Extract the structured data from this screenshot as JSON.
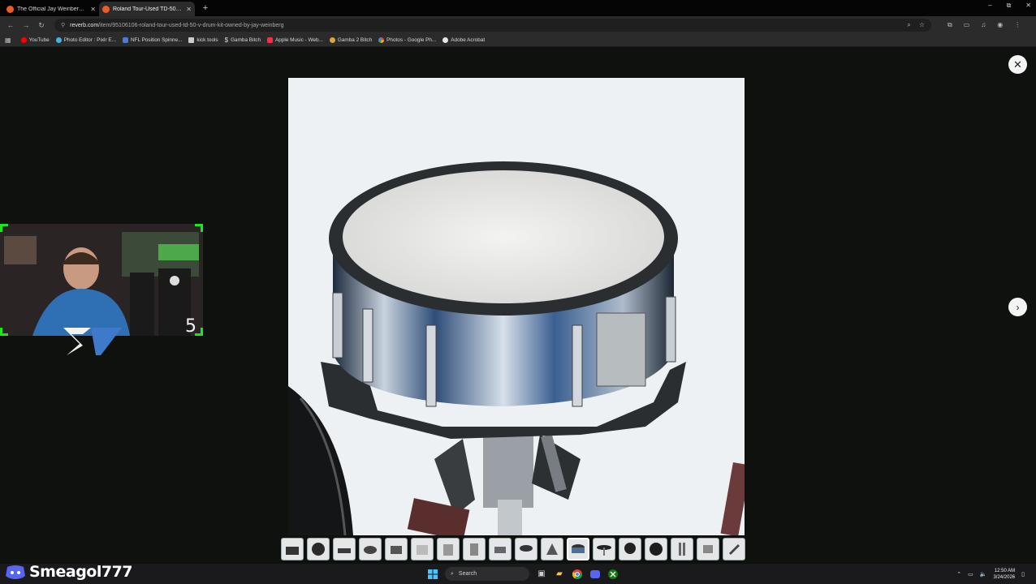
{
  "browser": {
    "tabs": [
      {
        "title": "The Official Jay Weinberg Reverb",
        "active": false
      },
      {
        "title": "Roland Tour-Used TD-50 V-Drum",
        "active": true
      }
    ],
    "new_tab": "+",
    "window_controls": {
      "minimize": "–",
      "restore": "⧉",
      "close": "✕"
    },
    "url_host": "reverb.com",
    "url_path": "/item/95106106-roland-tour-used-td-50-v-drum-kit-owned-by-jay-weinberg",
    "bookmarks": [
      {
        "label": "YouTube",
        "color": "#ff0000"
      },
      {
        "label": "Photo Editor : Pixlr E...",
        "color": "#3fb6e8"
      },
      {
        "label": "NFL Position Spinne...",
        "color": "#4b7bd6"
      },
      {
        "label": "kick tools",
        "color": "#cccccc"
      },
      {
        "label": "Gamba Bitch",
        "color": "#bbbbbb"
      },
      {
        "label": "Apple Music - Web...",
        "color": "#fa2d48"
      },
      {
        "label": "Gamba 2 Bitch",
        "color": "#d9a441"
      },
      {
        "label": "Photos - Google Ph...",
        "color": "#fbbc04"
      },
      {
        "label": "Adobe Acrobat",
        "color": "#e6e6e6"
      }
    ]
  },
  "viewer": {
    "close_label": "✕",
    "next_label": "›",
    "thumbnail_count": 18,
    "active_thumbnail": 12
  },
  "overlay": {
    "counter": "5",
    "streamer_name": "Smeagol777",
    "accent_color": "#1be81b"
  },
  "taskbar": {
    "search_placeholder": "Search",
    "time": "12:50 AM",
    "date": "3/24/2026"
  }
}
